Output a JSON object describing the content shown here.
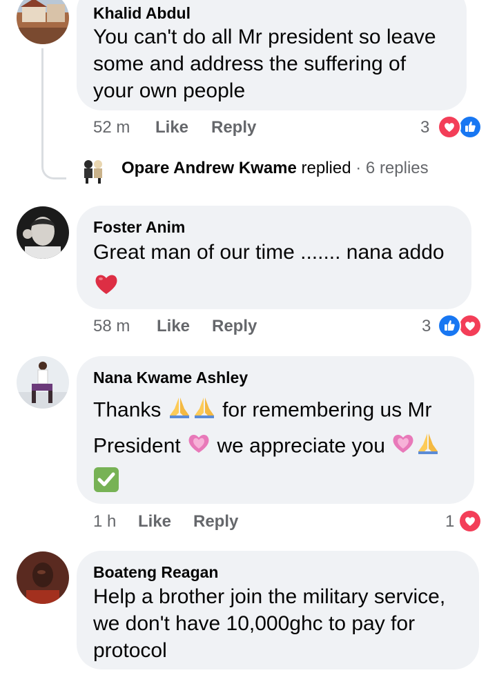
{
  "comments": [
    {
      "author": "Khalid Abdul",
      "lines": [
        "You can't do all Mr president so leave",
        "some and address  the suffering of",
        "your own people"
      ],
      "time": "52 m",
      "like_label": "Like",
      "reply_label": "Reply",
      "reaction_count": "3"
    },
    {
      "author": "Foster Anim",
      "lines": [
        "Great man of our time ....... nana addo"
      ],
      "time": "58 m",
      "like_label": "Like",
      "reply_label": "Reply",
      "reaction_count": "3"
    },
    {
      "author": "Nana Kwame Ashley",
      "line1a": "Thanks",
      "line1b": "for remembering us Mr",
      "line2a": "President",
      "line2b": "we appreciate you",
      "time": "1 h",
      "like_label": "Like",
      "reply_label": "Reply",
      "reaction_count": "1"
    },
    {
      "author": "Boateng Reagan",
      "lines": [
        "Help a brother join the military service,",
        "we don't have 10,000ghc to pay for",
        "protocol"
      ]
    }
  ],
  "reply_summary": {
    "name": "Opare Andrew Kwame",
    "replied": "replied",
    "separator": "·",
    "count": "6 replies"
  },
  "icons": {
    "like": "like-reaction-icon",
    "love": "love-reaction-icon",
    "heart_emoji": "red-heart-emoji",
    "pray_emoji": "folded-hands-emoji",
    "pink_heart_emoji": "pink-heart-emoji",
    "check_emoji": "check-mark-button-emoji"
  },
  "colors": {
    "bubble": "#f0f2f5",
    "meta_text": "#65676b",
    "like_blue": "#1877f2",
    "love_red": "#f33e58"
  }
}
